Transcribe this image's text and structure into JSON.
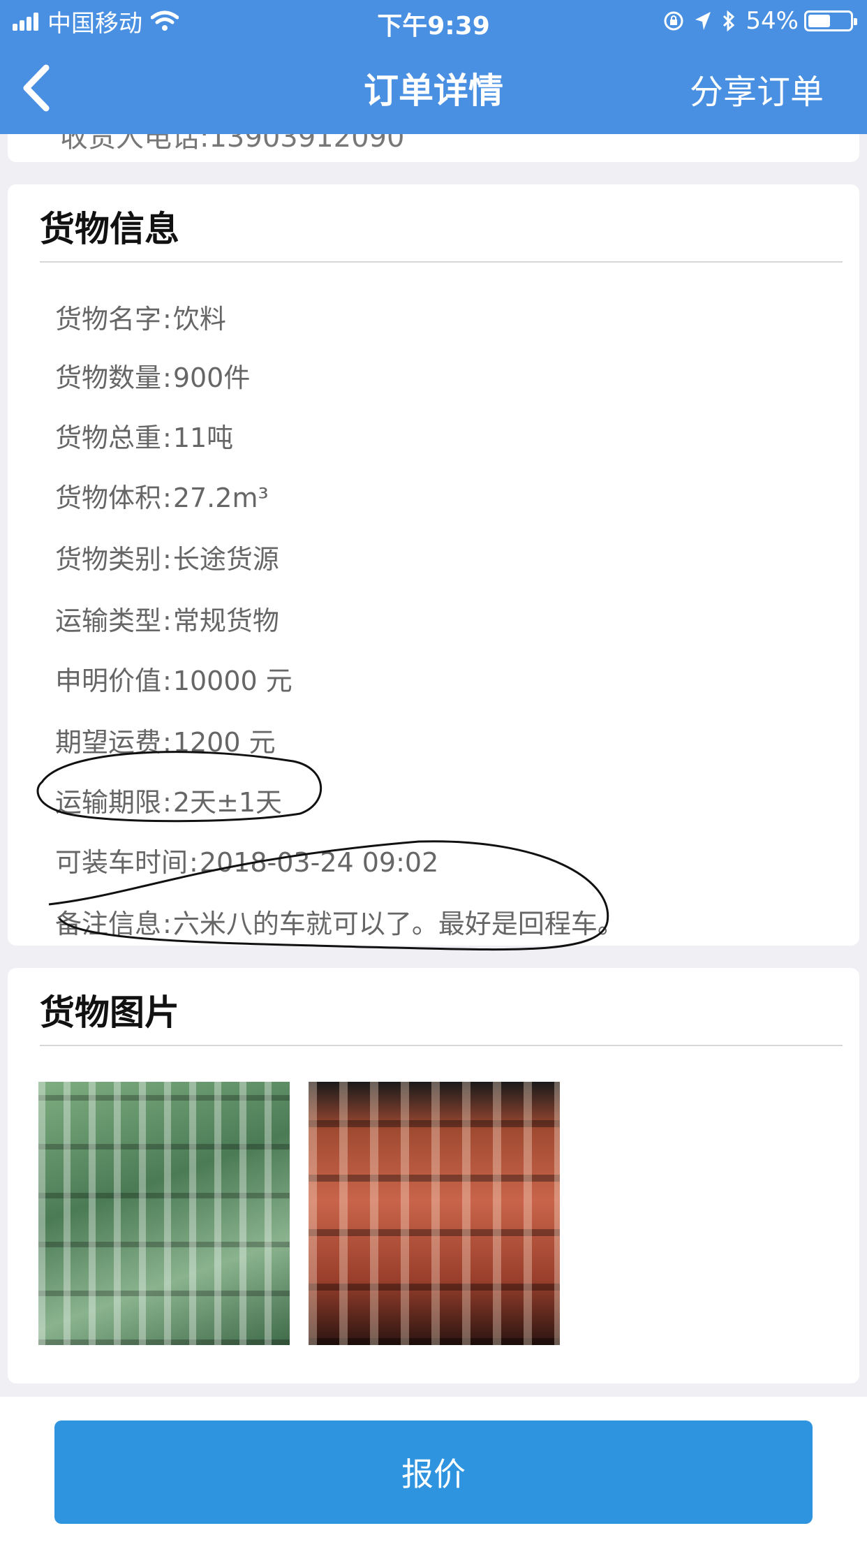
{
  "status_bar": {
    "carrier": "中国移动",
    "time": "下午9:39",
    "battery_percent": "54%",
    "battery_level": 0.54,
    "icons": [
      "signal-icon",
      "wifi-icon",
      "rotation-lock-icon",
      "location-icon",
      "bluetooth-icon",
      "battery-icon"
    ]
  },
  "nav": {
    "back_icon": "chevron-left-icon",
    "title": "订单详情",
    "share_label": "分享订单"
  },
  "top_card": {
    "cut_text": "收货人电话:13903912090"
  },
  "cargo_info": {
    "title": "货物信息",
    "rows": [
      {
        "label": "货物名字",
        "value": "饮料"
      },
      {
        "label": "货物数量",
        "value": "900件"
      },
      {
        "label": "货物总重",
        "value": "11吨"
      },
      {
        "label": "货物体积",
        "value": "27.2m³"
      },
      {
        "label": "货物类别",
        "value": "长途货源"
      },
      {
        "label": "运输类型",
        "value": "常规货物"
      },
      {
        "label": "申明价值",
        "value": "10000 元"
      },
      {
        "label": "期望运费",
        "value": "1200 元"
      },
      {
        "label": "运输期限",
        "value": "2天±1天"
      },
      {
        "label": "可装车时间",
        "value": "2018-03-24 09:02"
      },
      {
        "label": "备注信息",
        "value": "六米八的车就可以了。最好是回程车。"
      }
    ]
  },
  "cargo_photos": {
    "title": "货物图片"
  },
  "bottom": {
    "quote_label": "报价"
  },
  "colors": {
    "nav_blue": "#4a90e2",
    "button_blue": "#2f94e0",
    "background": "#efeff4"
  }
}
